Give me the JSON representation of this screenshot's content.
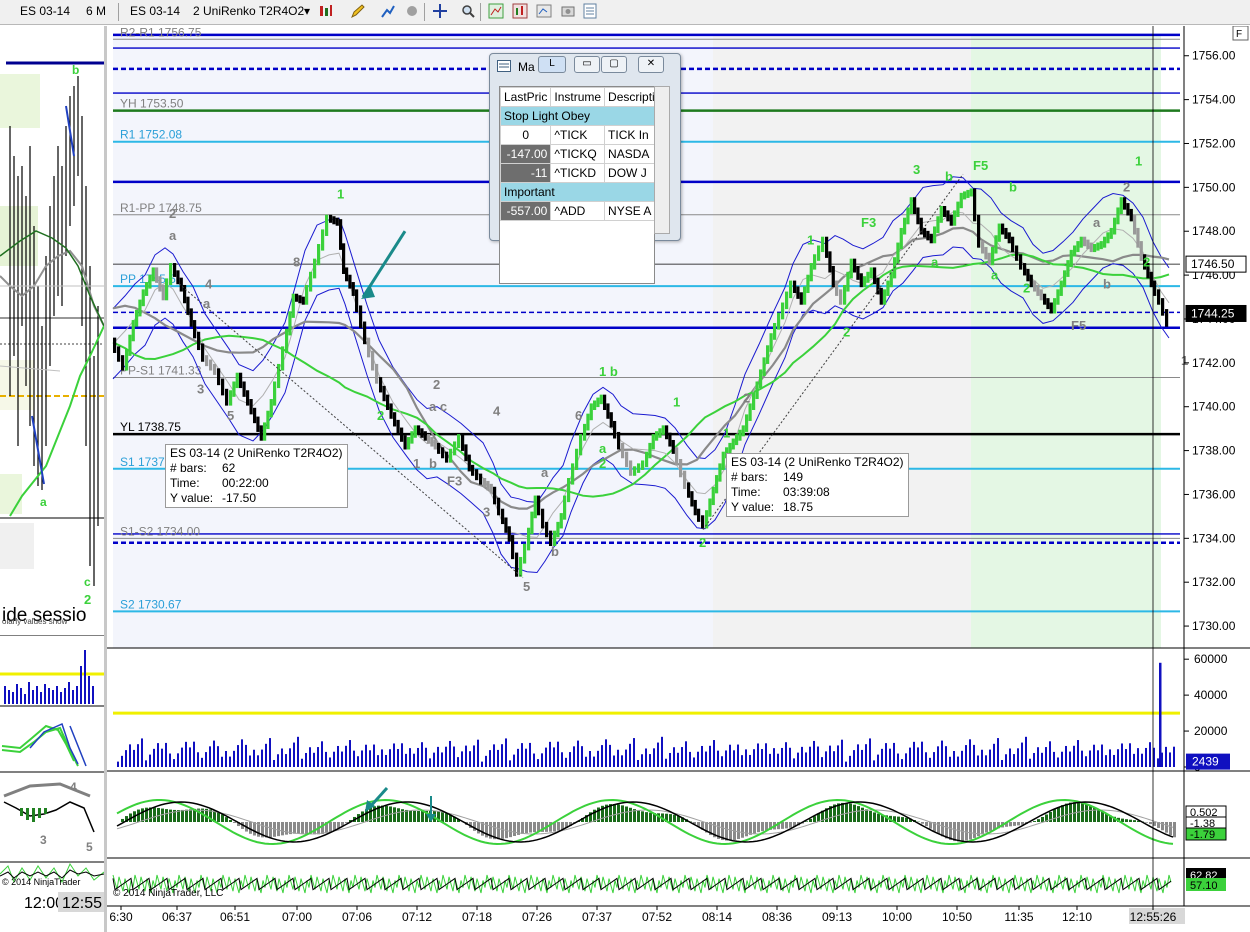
{
  "toolbar": {
    "left_instrument": "ES 03-14",
    "left_period": "6 M",
    "instrument": "ES 03-14",
    "bar_type": "2 UniRenko T2R4O2",
    "f_button": "F"
  },
  "left_panel": {
    "label_b": "b",
    "label_a": "a",
    "label_c": "c",
    "label_2": "2",
    "session_text": "ide sessio",
    "values_text": "olarly values snow",
    "label_3": "3",
    "label_4": "4",
    "label_5": "5",
    "copyright": "© 2014 NinjaTrader",
    "time_1": "12:00",
    "time_2": "12:55"
  },
  "chart_data": {
    "type": "line",
    "instrument": "ES 03-14 (2 UniRenko T2R4O2)",
    "price_axis": {
      "ylim": [
        1729.0,
        1756.9
      ],
      "ticks": [
        1756.0,
        1754.0,
        1752.0,
        1750.0,
        1748.0,
        1746.0,
        1744.0,
        1742.0,
        1740.0,
        1738.0,
        1736.0,
        1734.0,
        1732.0,
        1730.0
      ],
      "tick_labels": [
        "1756.00",
        "1754.00",
        "1752.00",
        "1750.00",
        "1748.00",
        "1746.00",
        "1744.00",
        "1742.00",
        "1740.00",
        "1738.00",
        "1736.00",
        "1734.00",
        "1732.00",
        "1730.00"
      ],
      "markers": [
        {
          "label": "1746.50",
          "value": 1746.5,
          "style": "plain"
        },
        {
          "label": "1744.25",
          "value": 1744.25,
          "style": "dark"
        }
      ]
    },
    "time_axis": {
      "labels": [
        "6:30",
        "06:37",
        "06:51",
        "07:00",
        "07:06",
        "07:12",
        "07:18",
        "07:26",
        "07:37",
        "07:52",
        "08:14",
        "08:36",
        "09:13",
        "10:00",
        "10:50",
        "11:35",
        "12:10",
        "12:55:26"
      ]
    },
    "levels": [
      {
        "label": "R2-R1 1756.75",
        "value": 1756.75,
        "color": "#8a8a8a"
      },
      {
        "label": "YH 1753.50",
        "value": 1753.5,
        "color": "#1e7a1e"
      },
      {
        "label": "R1 1752.08",
        "value": 1752.08,
        "color": "#2cb8e6"
      },
      {
        "label": "R1-PP 1748.75",
        "value": 1748.75,
        "color": "#8a8a8a"
      },
      {
        "label": "PP 1745.5",
        "value": 1745.5,
        "color": "#2cb8e6"
      },
      {
        "label": "PP-S1 1741.33",
        "value": 1741.33,
        "color": "#8a8a8a"
      },
      {
        "label": "YL 1738.75",
        "value": 1738.75,
        "color": "#000000"
      },
      {
        "label": "S1 1737",
        "value": 1737.17,
        "color": "#2cb8e6"
      },
      {
        "label": "S1-S2 1734.00",
        "value": 1734.0,
        "color": "#8a8a8a"
      },
      {
        "label": "S2 1730.67",
        "value": 1730.67,
        "color": "#2cb8e6"
      }
    ],
    "price_path": [
      [
        0,
        1743.0
      ],
      [
        12,
        1741.8
      ],
      [
        22,
        1743.8
      ],
      [
        32,
        1745.2
      ],
      [
        42,
        1746.2
      ],
      [
        52,
        1745.0
      ],
      [
        60,
        1746.4
      ],
      [
        70,
        1745.4
      ],
      [
        80,
        1743.8
      ],
      [
        92,
        1742.2
      ],
      [
        104,
        1741.6
      ],
      [
        116,
        1740.2
      ],
      [
        126,
        1741.4
      ],
      [
        140,
        1739.8
      ],
      [
        150,
        1738.6
      ],
      [
        160,
        1740.2
      ],
      [
        172,
        1742.6
      ],
      [
        182,
        1745.0
      ],
      [
        192,
        1744.8
      ],
      [
        204,
        1746.6
      ],
      [
        216,
        1748.6
      ],
      [
        226,
        1748.4
      ],
      [
        232,
        1746.2
      ],
      [
        242,
        1745.2
      ],
      [
        254,
        1743.0
      ],
      [
        266,
        1741.2
      ],
      [
        280,
        1739.6
      ],
      [
        294,
        1738.2
      ],
      [
        304,
        1739.0
      ],
      [
        314,
        1738.6
      ],
      [
        324,
        1738.2
      ],
      [
        336,
        1737.6
      ],
      [
        348,
        1738.6
      ],
      [
        358,
        1737.2
      ],
      [
        370,
        1736.6
      ],
      [
        380,
        1736.2
      ],
      [
        388,
        1735.2
      ],
      [
        398,
        1734.0
      ],
      [
        406,
        1732.4
      ],
      [
        414,
        1733.6
      ],
      [
        424,
        1735.8
      ],
      [
        432,
        1734.6
      ],
      [
        440,
        1733.8
      ],
      [
        450,
        1735.0
      ],
      [
        458,
        1736.6
      ],
      [
        470,
        1738.6
      ],
      [
        480,
        1740.0
      ],
      [
        490,
        1740.4
      ],
      [
        500,
        1739.2
      ],
      [
        508,
        1738.2
      ],
      [
        520,
        1737.0
      ],
      [
        532,
        1737.4
      ],
      [
        542,
        1738.6
      ],
      [
        552,
        1739.0
      ],
      [
        562,
        1738.0
      ],
      [
        574,
        1736.4
      ],
      [
        584,
        1735.2
      ],
      [
        592,
        1734.6
      ],
      [
        602,
        1736.2
      ],
      [
        612,
        1737.8
      ],
      [
        622,
        1738.4
      ],
      [
        632,
        1739.0
      ],
      [
        646,
        1741.0
      ],
      [
        660,
        1743.2
      ],
      [
        672,
        1744.6
      ],
      [
        680,
        1745.6
      ],
      [
        690,
        1744.8
      ],
      [
        700,
        1746.4
      ],
      [
        712,
        1747.6
      ],
      [
        722,
        1745.6
      ],
      [
        730,
        1744.8
      ],
      [
        740,
        1746.6
      ],
      [
        750,
        1745.6
      ],
      [
        760,
        1746.2
      ],
      [
        770,
        1744.8
      ],
      [
        780,
        1746.0
      ],
      [
        790,
        1748.0
      ],
      [
        800,
        1749.4
      ],
      [
        810,
        1748.0
      ],
      [
        820,
        1747.6
      ],
      [
        830,
        1749.0
      ],
      [
        840,
        1748.4
      ],
      [
        850,
        1749.6
      ],
      [
        860,
        1749.8
      ],
      [
        868,
        1747.4
      ],
      [
        878,
        1746.6
      ],
      [
        888,
        1748.2
      ],
      [
        898,
        1747.6
      ],
      [
        910,
        1746.4
      ],
      [
        920,
        1745.6
      ],
      [
        930,
        1745.0
      ],
      [
        940,
        1744.4
      ],
      [
        950,
        1745.6
      ],
      [
        960,
        1747.0
      ],
      [
        970,
        1747.6
      ],
      [
        980,
        1747.2
      ],
      [
        990,
        1747.4
      ],
      [
        1000,
        1748.0
      ],
      [
        1010,
        1749.4
      ],
      [
        1020,
        1748.6
      ],
      [
        1030,
        1746.8
      ],
      [
        1040,
        1745.6
      ],
      [
        1048,
        1744.8
      ],
      [
        1056,
        1743.8
      ]
    ],
    "wave_labels": [
      {
        "text": "2",
        "t": 56,
        "p": 1748.6,
        "color": "#808080"
      },
      {
        "text": "a",
        "t": 56,
        "p": 1747.6,
        "color": "#808080"
      },
      {
        "text": "1",
        "t": 224,
        "p": 1749.5,
        "color": "#3bd13b"
      },
      {
        "text": "8",
        "t": 180,
        "p": 1746.4,
        "color": "#808080"
      },
      {
        "text": "4",
        "t": 92,
        "p": 1745.4,
        "color": "#808080"
      },
      {
        "text": "a",
        "t": 90,
        "p": 1744.5,
        "color": "#808080"
      },
      {
        "text": "3",
        "t": 84,
        "p": 1740.6,
        "color": "#808080"
      },
      {
        "text": "5",
        "t": 114,
        "p": 1739.4,
        "color": "#808080"
      },
      {
        "text": "7",
        "t": 148,
        "p": 1737.8,
        "color": "#808080"
      },
      {
        "text": "2",
        "t": 264,
        "p": 1739.4,
        "color": "#3bd13b"
      },
      {
        "text": "1",
        "t": 300,
        "p": 1737.2,
        "color": "#808080"
      },
      {
        "text": "b",
        "t": 316,
        "p": 1737.2,
        "color": "#808080"
      },
      {
        "text": "F3",
        "t": 334,
        "p": 1736.4,
        "color": "#808080"
      },
      {
        "text": "2",
        "t": 320,
        "p": 1740.8,
        "color": "#808080"
      },
      {
        "text": "a c",
        "t": 316,
        "p": 1739.8,
        "color": "#808080"
      },
      {
        "text": "4",
        "t": 380,
        "p": 1739.6,
        "color": "#808080"
      },
      {
        "text": "3",
        "t": 370,
        "p": 1735.0,
        "color": "#808080"
      },
      {
        "text": "5",
        "t": 410,
        "p": 1731.6,
        "color": "#808080"
      },
      {
        "text": "a",
        "t": 428,
        "p": 1736.8,
        "color": "#808080"
      },
      {
        "text": "b",
        "t": 438,
        "p": 1733.2,
        "color": "#808080"
      },
      {
        "text": "6",
        "t": 462,
        "p": 1739.4,
        "color": "#808080"
      },
      {
        "text": "1 b",
        "t": 486,
        "p": 1741.4,
        "color": "#3bd13b"
      },
      {
        "text": "a",
        "t": 486,
        "p": 1737.9,
        "color": "#3bd13b"
      },
      {
        "text": "2",
        "t": 486,
        "p": 1737.2,
        "color": "#3bd13b"
      },
      {
        "text": "1",
        "t": 560,
        "p": 1740.0,
        "color": "#3bd13b"
      },
      {
        "text": "2",
        "t": 586,
        "p": 1733.6,
        "color": "#3bd13b"
      },
      {
        "text": "1",
        "t": 610,
        "p": 1738.6,
        "color": "#3bd13b"
      },
      {
        "text": "2",
        "t": 630,
        "p": 1740.2,
        "color": "#808080"
      },
      {
        "text": "1",
        "t": 694,
        "p": 1747.4,
        "color": "#3bd13b"
      },
      {
        "text": "2",
        "t": 730,
        "p": 1743.2,
        "color": "#3bd13b"
      },
      {
        "text": "F3",
        "t": 748,
        "p": 1748.2,
        "color": "#3bd13b"
      },
      {
        "text": "3",
        "t": 800,
        "p": 1750.6,
        "color": "#3bd13b"
      },
      {
        "text": "b",
        "t": 832,
        "p": 1750.3,
        "color": "#3bd13b"
      },
      {
        "text": "F5",
        "t": 860,
        "p": 1750.8,
        "color": "#3bd13b"
      },
      {
        "text": "a",
        "t": 818,
        "p": 1746.4,
        "color": "#3bd13b"
      },
      {
        "text": "a",
        "t": 878,
        "p": 1745.8,
        "color": "#3bd13b"
      },
      {
        "text": "b",
        "t": 896,
        "p": 1749.8,
        "color": "#3bd13b"
      },
      {
        "text": "2",
        "t": 910,
        "p": 1745.2,
        "color": "#3bd13b"
      },
      {
        "text": "a",
        "t": 980,
        "p": 1748.2,
        "color": "#808080"
      },
      {
        "text": "b",
        "t": 990,
        "p": 1745.4,
        "color": "#808080"
      },
      {
        "text": "F5",
        "t": 958,
        "p": 1743.5,
        "color": "#808080"
      },
      {
        "text": "2",
        "t": 1010,
        "p": 1749.8,
        "color": "#808080"
      },
      {
        "text": "1",
        "t": 1022,
        "p": 1751.0,
        "color": "#3bd13b"
      },
      {
        "text": "2",
        "t": 1030,
        "p": 1746.4,
        "color": "#3bd13b"
      },
      {
        "text": "1",
        "t": 1068,
        "p": 1741.9,
        "color": "#808080"
      }
    ],
    "tooltips": [
      {
        "title": "ES 03-14 (2 UniRenko T2R4O2)",
        "bars_label": "# bars:",
        "bars": "62",
        "time_label": "Time:",
        "time": "00:22:00",
        "y_label": "Y value:",
        "y": "-17.50"
      },
      {
        "title": "ES 03-14 (2 UniRenko T2R4O2)",
        "bars_label": "# bars:",
        "bars": "149",
        "time_label": "Time:",
        "time": "03:39:08",
        "y_label": "Y value:",
        "y": "18.75"
      }
    ],
    "volume": {
      "ticks": [
        "60000",
        "40000",
        "20000",
        "0"
      ],
      "ylim": [
        0,
        64000
      ],
      "current": "2439",
      "threshold": 30000,
      "spike": 58000
    },
    "macd": {
      "labels": [
        "0.502",
        "-1.38",
        "-1.79"
      ]
    },
    "oscillator": {
      "labels": [
        "62.82",
        "57.10"
      ]
    },
    "copyright": "© 2014 NinjaTrader, LLC"
  },
  "market_analyzer": {
    "title": "Ma",
    "tab": "L",
    "columns": [
      "LastPric",
      "Instrume",
      "Descripti"
    ],
    "group1": "Stop Light Obey",
    "rows1": [
      {
        "last": "0",
        "inst": "^TICK",
        "desc": "TICK In"
      },
      {
        "last": "-147.00",
        "inst": "^TICKQ",
        "desc": "NASDA"
      },
      {
        "last": "-11",
        "inst": "^TICKD",
        "desc": "DOW J"
      }
    ],
    "group2": "Important",
    "rows2": [
      {
        "last": "-557.00",
        "inst": "^ADD",
        "desc": "NYSE A"
      }
    ]
  },
  "colors": {
    "up_bar": "#3bd13b",
    "down_bar": "#000000",
    "pivot_blue": "#0000c8",
    "level_cyan": "#2cb8e6",
    "macd_hist": "#1a6b1a",
    "volume": "#1010c0",
    "threshold": "#f0f000"
  }
}
